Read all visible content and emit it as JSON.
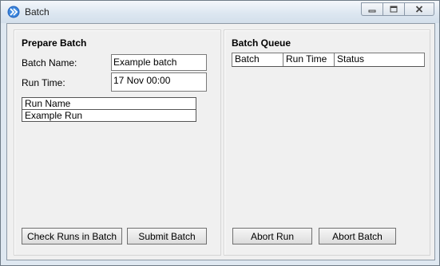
{
  "window": {
    "title": "Batch"
  },
  "prepare": {
    "title": "Prepare Batch",
    "batch_name_label": "Batch Name:",
    "batch_name_value": "Example batch",
    "run_time_label": "Run Time:",
    "run_time_value": "17 Nov 00:00",
    "runs_header": "Run Name",
    "runs": [
      "Example Run"
    ],
    "check_button": "Check Runs in Batch",
    "submit_button": "Submit  Batch"
  },
  "queue": {
    "title": "Batch Queue",
    "columns": [
      "Batch",
      "Run Time",
      "Status"
    ],
    "abort_run_button": "Abort Run",
    "abort_batch_button": "Abort Batch"
  }
}
